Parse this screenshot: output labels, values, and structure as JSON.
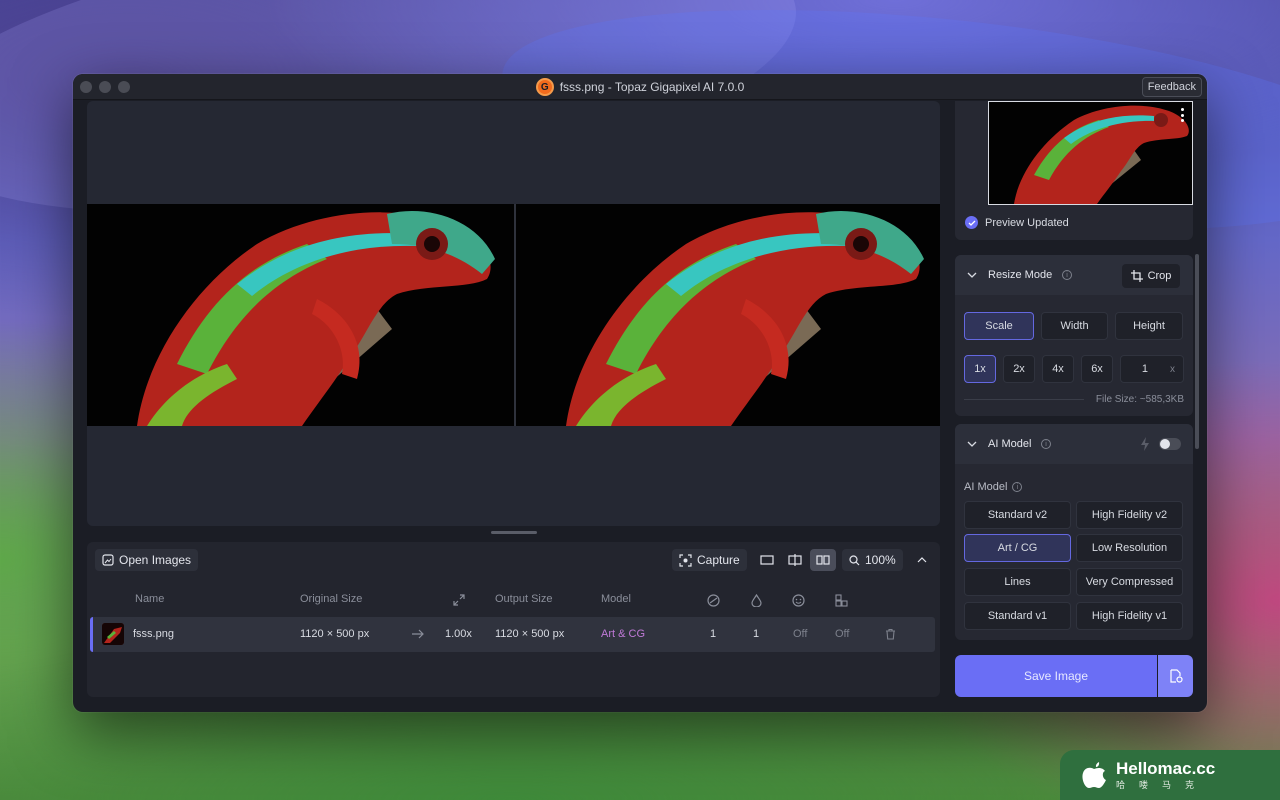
{
  "window": {
    "title": "fsss.png - Topaz Gigapixel AI 7.0.0",
    "logo_letter": "G",
    "feedback_label": "Feedback"
  },
  "toolbar": {
    "open_images_label": "Open Images",
    "capture_label": "Capture",
    "zoom_label": "100%"
  },
  "table": {
    "headers": {
      "name": "Name",
      "original_size": "Original Size",
      "output_size": "Output Size",
      "model": "Model"
    },
    "rows": [
      {
        "name": "fsss.png",
        "original_size": "1120 × 500 px",
        "scale": "1.00x",
        "output_size": "1120 × 500 px",
        "model": "Art & CG",
        "val1": "1",
        "val2": "1",
        "val3": "Off",
        "val4": "Off"
      }
    ]
  },
  "sidebar": {
    "preview_status": "Preview Updated",
    "resize": {
      "title": "Resize Mode",
      "crop_label": "Crop",
      "modes": [
        "Scale",
        "Width",
        "Height"
      ],
      "active_mode": "Scale",
      "scales": [
        "1x",
        "2x",
        "4x",
        "6x"
      ],
      "active_scale": "1x",
      "custom_value": "1",
      "custom_unit": "x",
      "file_size": "File Size: ~585,3KB"
    },
    "ai_model": {
      "title": "AI Model",
      "section_label": "AI Model",
      "models": [
        "Standard v2",
        "High Fidelity v2",
        "Art / CG",
        "Low Resolution",
        "Lines",
        "Very Compressed",
        "Standard v1",
        "High Fidelity v1"
      ],
      "active_model": "Art / CG",
      "toggle_on": false
    },
    "save_label": "Save Image"
  },
  "watermark": {
    "title": "Hellomac.cc",
    "subtitle": "哈喽马克"
  },
  "colors": {
    "accent": "#6a6ef5",
    "model_text": "#c07ad8",
    "app_logo": "#f26b1d"
  }
}
